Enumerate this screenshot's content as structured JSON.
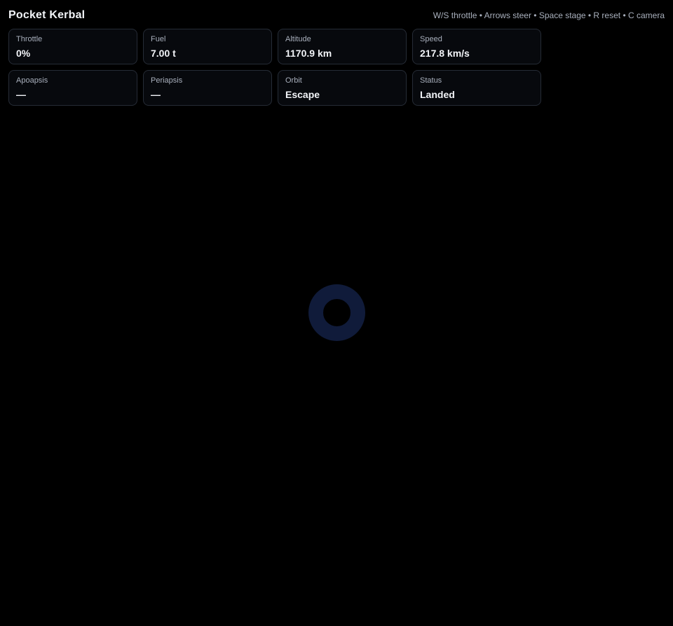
{
  "app": {
    "title": "Pocket Kerbal",
    "controls_help": "W/S throttle • Arrows steer • Space stage • R reset • C camera"
  },
  "stats": [
    {
      "label": "Throttle",
      "value": "0%"
    },
    {
      "label": "Fuel",
      "value": "7.00 t"
    },
    {
      "label": "Altitude",
      "value": "1170.9 km"
    },
    {
      "label": "Speed",
      "value": "217.8 km/s"
    },
    {
      "label": "Apoapsis",
      "value": "—"
    },
    {
      "label": "Periapsis",
      "value": "—"
    },
    {
      "label": "Orbit",
      "value": "Escape"
    },
    {
      "label": "Status",
      "value": "Landed"
    }
  ],
  "colors": {
    "background": "#000000",
    "card_background": "#07090d",
    "card_border": "#262c36",
    "planet": "#101b3a",
    "label_text": "#a9b0bd",
    "value_text": "#f2f4f8"
  }
}
